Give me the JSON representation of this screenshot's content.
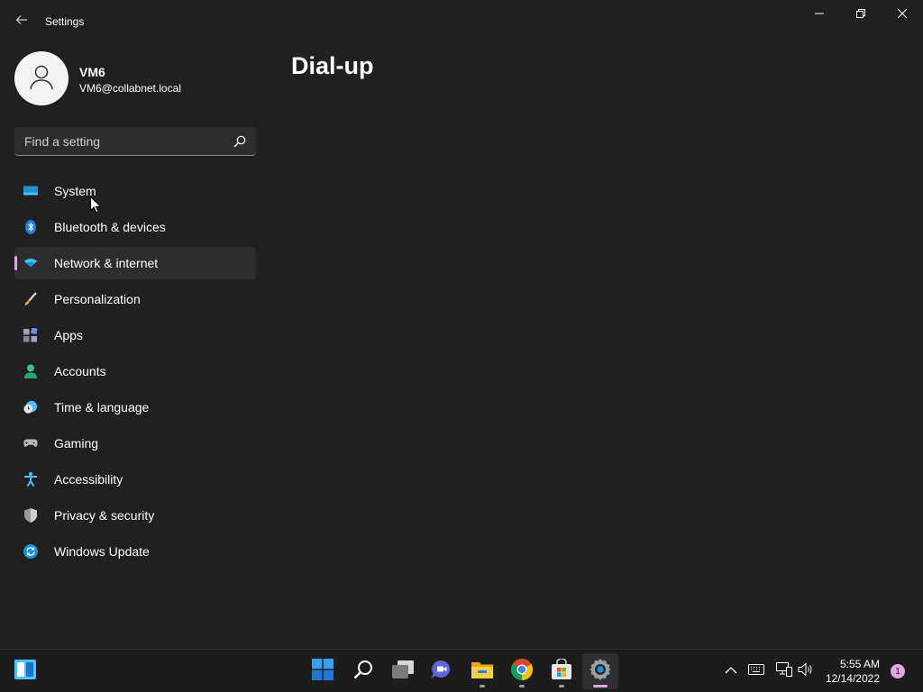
{
  "window": {
    "title": "Settings"
  },
  "profile": {
    "name": "VM6",
    "email": "VM6@collabnet.local"
  },
  "search": {
    "placeholder": "Find a setting"
  },
  "nav": {
    "items": [
      {
        "label": "System",
        "icon": "system-icon",
        "active": false
      },
      {
        "label": "Bluetooth & devices",
        "icon": "bluetooth-icon",
        "active": false
      },
      {
        "label": "Network & internet",
        "icon": "network-icon",
        "active": true
      },
      {
        "label": "Personalization",
        "icon": "brush-icon",
        "active": false
      },
      {
        "label": "Apps",
        "icon": "apps-icon",
        "active": false
      },
      {
        "label": "Accounts",
        "icon": "accounts-icon",
        "active": false
      },
      {
        "label": "Time & language",
        "icon": "clock-globe-icon",
        "active": false
      },
      {
        "label": "Gaming",
        "icon": "gamepad-icon",
        "active": false
      },
      {
        "label": "Accessibility",
        "icon": "accessibility-icon",
        "active": false
      },
      {
        "label": "Privacy & security",
        "icon": "shield-icon",
        "active": false
      },
      {
        "label": "Windows Update",
        "icon": "update-icon",
        "active": false
      }
    ]
  },
  "main": {
    "title": "Dial-up"
  },
  "taskbar": {
    "clock_time": "5:55 AM",
    "clock_date": "12/14/2022",
    "notification_count": "1",
    "apps": [
      "widgets-icon",
      "start-icon",
      "search-icon",
      "task-view-icon",
      "chat-icon",
      "file-explorer-icon",
      "chrome-icon",
      "store-icon",
      "settings-icon"
    ]
  },
  "colors": {
    "background": "#202020",
    "sidebar_selected": "#2d2d2d",
    "accent": "#e3a6e6",
    "taskbar": "#1c1c1c"
  }
}
